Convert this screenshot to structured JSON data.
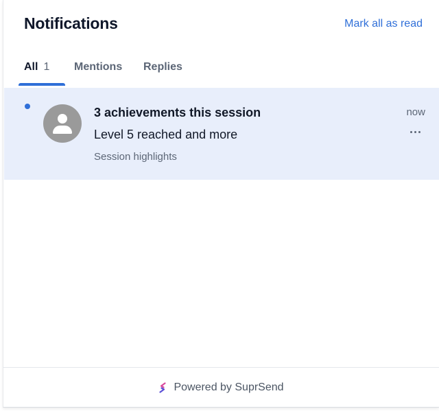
{
  "header": {
    "title": "Notifications",
    "mark_all_label": "Mark all as read"
  },
  "tabs": [
    {
      "label": "All",
      "count": "1",
      "active": true
    },
    {
      "label": "Mentions",
      "active": false
    },
    {
      "label": "Replies",
      "active": false
    }
  ],
  "notifications": [
    {
      "unread": true,
      "avatar": "user-avatar-icon",
      "title": "3 achievements this session",
      "body": "Level 5 reached and more",
      "subtext": "Session highlights",
      "time": "now",
      "menu_icon": "more-horizontal-icon"
    }
  ],
  "footer": {
    "label": "Powered by SuprSend",
    "logo_icon": "suprsend-logo-icon"
  },
  "colors": {
    "accent": "#2f6fd8",
    "unread_bg": "#e8eefb",
    "text_primary": "#0f172a",
    "text_muted": "#5c6676",
    "avatar_bg": "#9a9a9a"
  }
}
